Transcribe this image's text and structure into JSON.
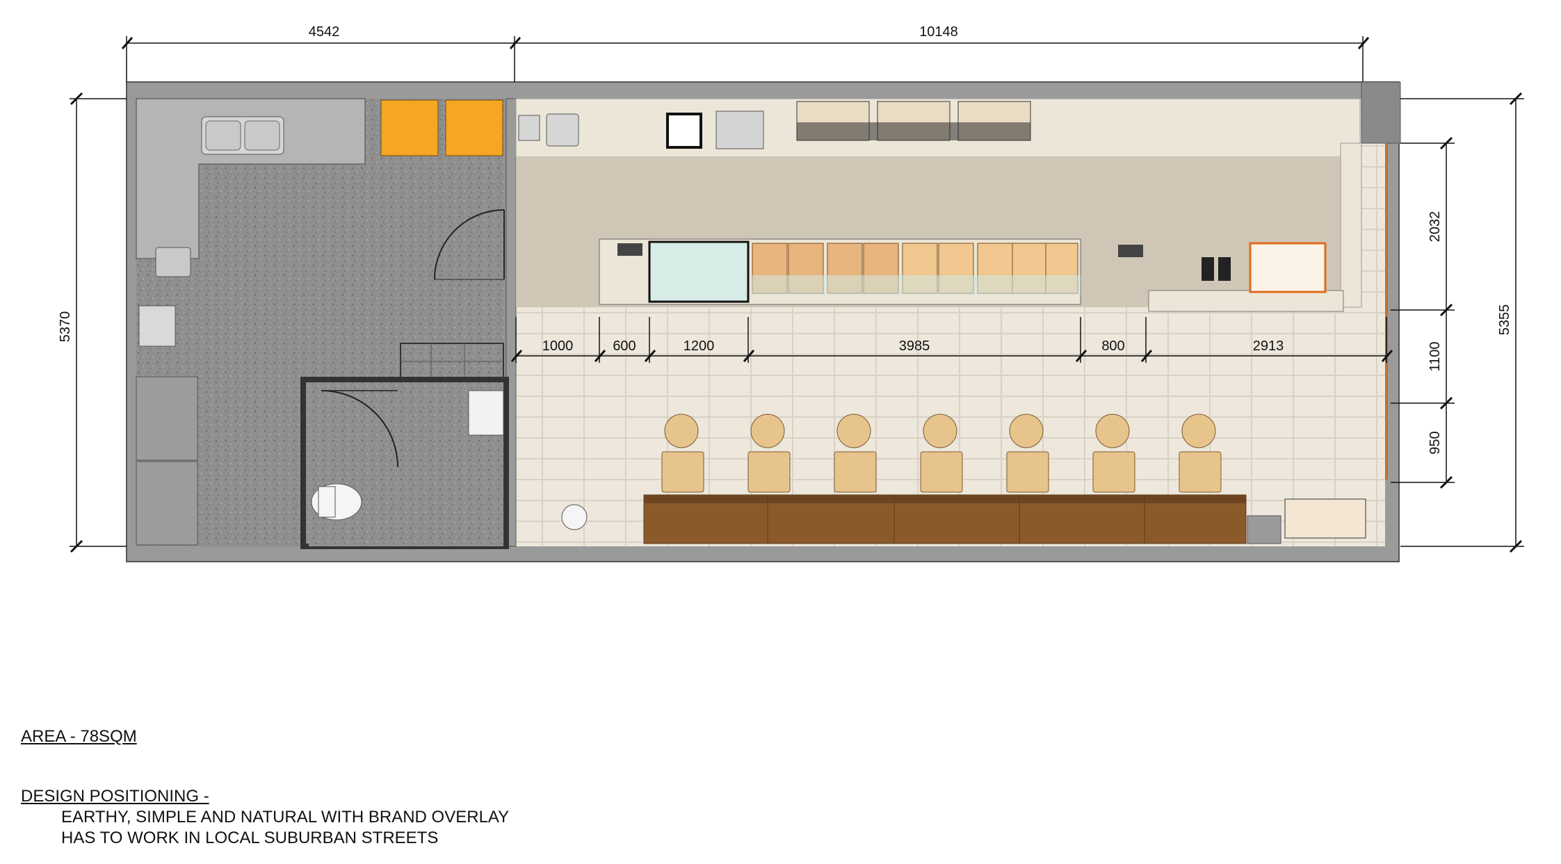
{
  "dimensions": {
    "top": [
      "4542",
      "10148"
    ],
    "left": "5370",
    "right_outer": "5355",
    "right_segments": [
      "2032",
      "1100",
      "950"
    ],
    "counter_segments": [
      "1000",
      "600",
      "1200",
      "3985",
      "800",
      "2913"
    ]
  },
  "notes": {
    "area": "AREA - 78SQM",
    "design_heading": "DESIGN POSITIONING -",
    "design_lines": [
      "EARTHY, SIMPLE AND NATURAL WITH BRAND OVERLAY",
      "HAS TO WORK IN LOCAL SUBURBAN STREETS"
    ]
  },
  "colors": {
    "wall": "#9a9a9a",
    "kitchen_floor": "#8f8f8f",
    "stainless": "#b5b5b5",
    "orange_appliance": "#f5a623",
    "back_counter": "#ece6d8",
    "service_floor": "#cfc6b6",
    "tile_floor": "#ede7dc",
    "bench": "#8b5a2b",
    "timber": "#e8c48d"
  }
}
